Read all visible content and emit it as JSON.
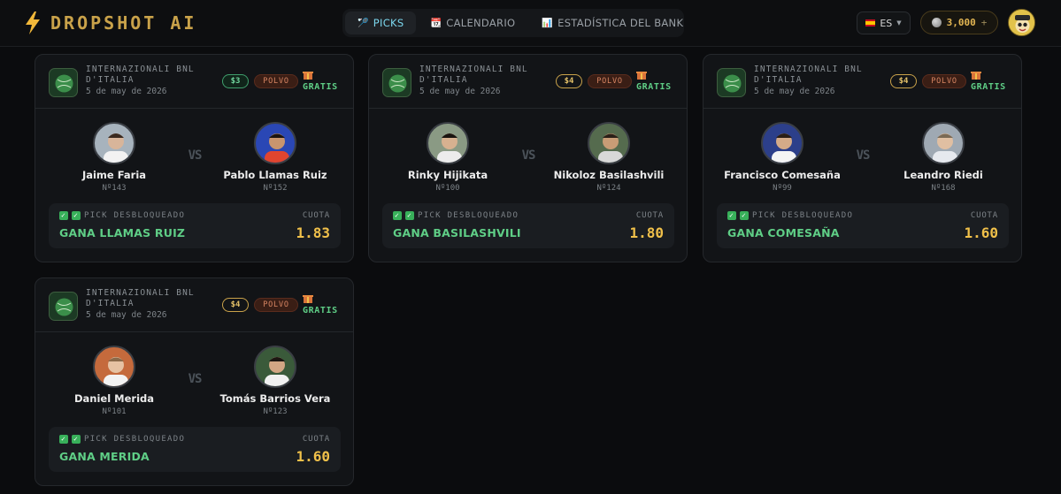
{
  "app": {
    "title": "DROPSHOT AI"
  },
  "nav": {
    "tabs": [
      {
        "icon": "tennis-racket-icon",
        "label": "PICKS"
      },
      {
        "icon": "calendar-icon",
        "label": "CALENDARIO"
      },
      {
        "icon": "bar-chart-icon",
        "label": "ESTADÍSTICA DEL BANK"
      }
    ],
    "active_tab": "PICKS"
  },
  "header": {
    "language": "ES",
    "coins": "3,000",
    "coins_add": "+"
  },
  "colors": {
    "accent_gold": "#c9a24a",
    "pick_green": "#5fce86",
    "odds_gold": "#f0c04a",
    "surface_clay": "#d98663",
    "active_tab": "#7cd7ee"
  },
  "labels": {
    "vs": "VS",
    "pick_unlocked": "PICK DESBLOQUEADO",
    "odds": "CUOTA",
    "free": "GRATIS"
  },
  "picks": [
    {
      "tournament": "INTERNAZIONALI BNL D'ITALIA",
      "date": "5 de may de 2026",
      "stake": "$3",
      "surface": "POLVO",
      "free": "GRATIS",
      "player1": {
        "name": "Jaime Faria",
        "rank": "Nº143"
      },
      "player2": {
        "name": "Pablo Llamas Ruiz",
        "rank": "Nº152"
      },
      "pick": "GANA LLAMAS RUIZ",
      "odds": "1.83"
    },
    {
      "tournament": "INTERNAZIONALI BNL D'ITALIA",
      "date": "5 de may de 2026",
      "stake": "$4",
      "surface": "POLVO",
      "free": "GRATIS",
      "player1": {
        "name": "Rinky Hijikata",
        "rank": "Nº100"
      },
      "player2": {
        "name": "Nikoloz Basilashvili",
        "rank": "Nº124"
      },
      "pick": "GANA BASILASHVILI",
      "odds": "1.80"
    },
    {
      "tournament": "INTERNAZIONALI BNL D'ITALIA",
      "date": "5 de may de 2026",
      "stake": "$4",
      "surface": "POLVO",
      "free": "GRATIS",
      "player1": {
        "name": "Francisco Comesaña",
        "rank": "Nº99"
      },
      "player2": {
        "name": "Leandro Riedi",
        "rank": "Nº168"
      },
      "pick": "GANA COMESAÑA",
      "odds": "1.60"
    },
    {
      "tournament": "INTERNAZIONALI BNL D'ITALIA",
      "date": "5 de may de 2026",
      "stake": "$4",
      "surface": "POLVO",
      "free": "GRATIS",
      "player1": {
        "name": "Daniel Merida",
        "rank": "Nº101"
      },
      "player2": {
        "name": "Tomás Barrios Vera",
        "rank": "Nº123"
      },
      "pick": "GANA MERIDA",
      "odds": "1.60"
    }
  ]
}
